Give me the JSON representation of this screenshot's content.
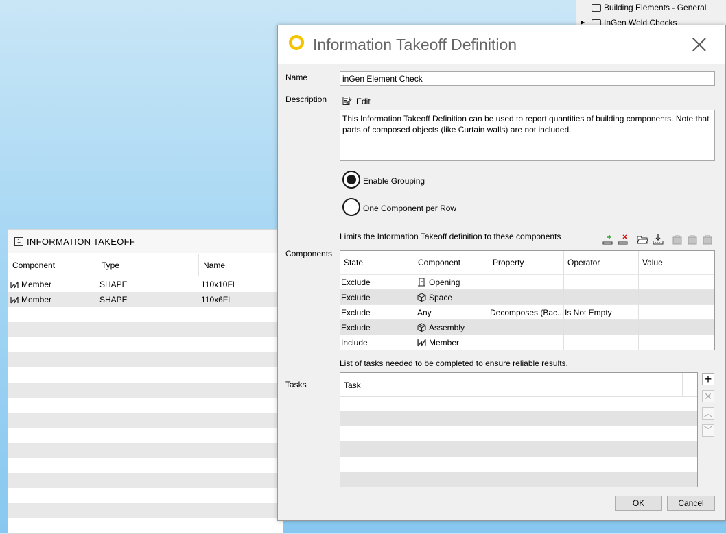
{
  "tree": {
    "items": [
      {
        "label": "Building Elements - General",
        "arrow": ""
      },
      {
        "label": "InGen Weld Checks",
        "arrow": "▶"
      }
    ]
  },
  "left_panel": {
    "title": "INFORMATION TAKEOFF",
    "columns": [
      "Component",
      "Type",
      "Name"
    ],
    "rows": [
      {
        "component": "Member",
        "type": "SHAPE",
        "name": "110x10FL"
      },
      {
        "component": "Member",
        "type": "SHAPE",
        "name": "110x6FL"
      }
    ]
  },
  "dialog": {
    "title": "Information Takeoff Definition",
    "name_label": "Name",
    "name_value": "inGen Element Check",
    "description_label": "Description",
    "edit_label": "Edit",
    "description_text": "This Information Takeoff Definition can be used to report quantities of building components. Note that parts of composed objects (like Curtain walls) are not included.",
    "grouping_options": [
      "Enable Grouping",
      "One Component per Row"
    ],
    "selected_grouping": "Enable Grouping",
    "components_label": "Components",
    "components_hint": "Limits the Information Takeoff definition to these components",
    "components_columns": [
      "State",
      "Component",
      "Property",
      "Operator",
      "Value"
    ],
    "components_rows": [
      {
        "state": "Exclude",
        "component": "Opening",
        "icon": "opening-icon",
        "property": "",
        "operator": "",
        "value": ""
      },
      {
        "state": "Exclude",
        "component": "Space",
        "icon": "space-icon",
        "property": "",
        "operator": "",
        "value": ""
      },
      {
        "state": "Exclude",
        "component": "Any",
        "icon": "",
        "property": "Decomposes (Bac...",
        "operator": "Is Not Empty",
        "value": ""
      },
      {
        "state": "Exclude",
        "component": "Assembly",
        "icon": "assembly-icon",
        "property": "",
        "operator": "",
        "value": ""
      },
      {
        "state": "Include",
        "component": "Member",
        "icon": "member-icon",
        "property": "",
        "operator": "",
        "value": ""
      }
    ],
    "tasks_label": "Tasks",
    "tasks_hint": "List of tasks needed to be completed to ensure reliable results.",
    "tasks_column": "Task",
    "ok_label": "OK",
    "cancel_label": "Cancel"
  },
  "colors": {
    "logo": "#f3c300",
    "add_icon": "#2ea82e",
    "remove_icon": "#d01818",
    "alt_row": "#e3e3e3"
  }
}
